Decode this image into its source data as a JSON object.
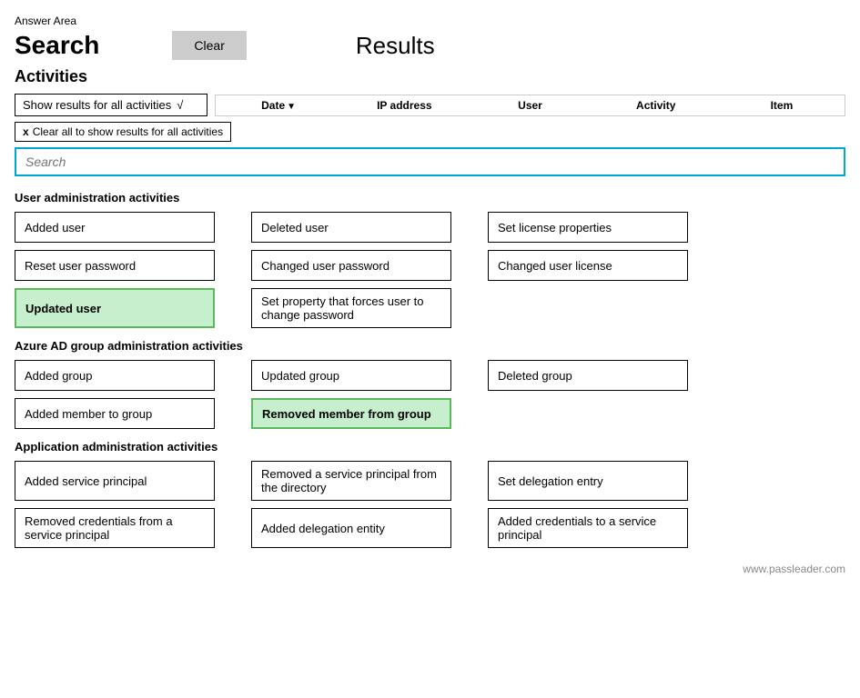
{
  "page": {
    "answer_area_label": "Answer Area",
    "search_title": "Search",
    "clear_button": "Clear",
    "results_title": "Results",
    "activities_section_title": "Activities",
    "filter_dropdown_label": "Show results for all activities",
    "filter_dropdown_icon": "✓",
    "clear_tag_label": "Clear all to show results for all activities",
    "search_placeholder": "Search",
    "columns": {
      "date": "Date",
      "ip_address": "IP address",
      "user": "User",
      "activity": "Activity",
      "item": "Item"
    },
    "user_admin_section": "User administration activities",
    "azure_ad_section": "Azure AD group administration activities",
    "app_admin_section": "Application administration activities",
    "user_admin_activities": [
      {
        "label": "Added user",
        "selected": false
      },
      {
        "label": "Deleted user",
        "selected": false
      },
      {
        "label": "Set license properties",
        "selected": false
      },
      {
        "label": "Reset user password",
        "selected": false
      },
      {
        "label": "Changed user password",
        "selected": false
      },
      {
        "label": "Changed user license",
        "selected": false
      },
      {
        "label": "Updated user",
        "selected": true
      },
      {
        "label": "Set property that forces user to change password",
        "selected": false
      }
    ],
    "azure_ad_activities": [
      {
        "label": "Added group",
        "selected": false
      },
      {
        "label": "Updated group",
        "selected": false
      },
      {
        "label": "Deleted group",
        "selected": false
      },
      {
        "label": "Added member to group",
        "selected": false
      },
      {
        "label": "Removed member from group",
        "selected": true
      }
    ],
    "app_admin_activities": [
      {
        "label": "Added service principal",
        "selected": false
      },
      {
        "label": "Removed a service principal from the directory",
        "selected": false
      },
      {
        "label": "Set delegation entry",
        "selected": false
      },
      {
        "label": "Removed credentials from a service principal",
        "selected": false
      },
      {
        "label": "Added delegation entity",
        "selected": false
      },
      {
        "label": "Added credentials to a service principal",
        "selected": false
      }
    ],
    "watermark": "www.passleader.com"
  }
}
